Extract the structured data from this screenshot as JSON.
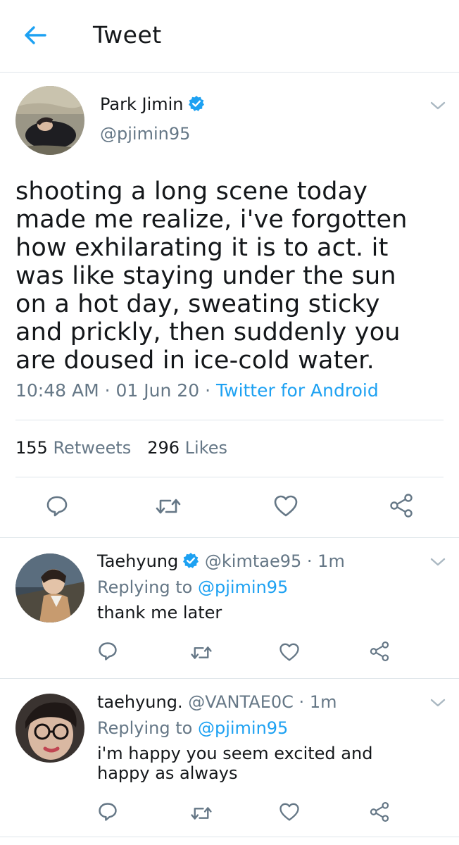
{
  "header": {
    "back_icon": "arrow-left-icon",
    "title": "Tweet"
  },
  "colors": {
    "accent": "#1da1f2",
    "muted": "#657786",
    "text": "#14171a",
    "divider": "#dfe6ea"
  },
  "tweet": {
    "author_name": "Park Jimin",
    "author_handle": "@pjimin95",
    "verified": true,
    "text_lines": [
      "shooting a long scene today",
      "made me realize, i've forgotten",
      "how exhilarating it is to act. it",
      "was like staying under the sun",
      "on a hot day, sweating sticky",
      "and prickly, then suddenly you",
      "are doused in ice-cold water."
    ],
    "time": "10:48 AM",
    "date": "01 Jun 20",
    "source": "Twitter for Android",
    "sep": "·",
    "retweets_count": "155",
    "retweets_label": "Retweets",
    "likes_count": "296",
    "likes_label": "Likes",
    "actions": [
      "reply-icon",
      "retweet-icon",
      "like-icon",
      "share-icon"
    ]
  },
  "replies": [
    {
      "name": "Taehyung",
      "verified": true,
      "handle": "@kimtae95",
      "time": "1m",
      "replying_prefix": "Replying to",
      "replying_to": "@pjimin95",
      "text_lines": [
        "thank me later"
      ]
    },
    {
      "name": "taehyung.",
      "verified": false,
      "handle": "@VANTAE0C",
      "time": "1m",
      "replying_prefix": "Replying to",
      "replying_to": "@pjimin95",
      "text_lines": [
        "i'm happy you seem excited and",
        "happy as always"
      ]
    }
  ]
}
